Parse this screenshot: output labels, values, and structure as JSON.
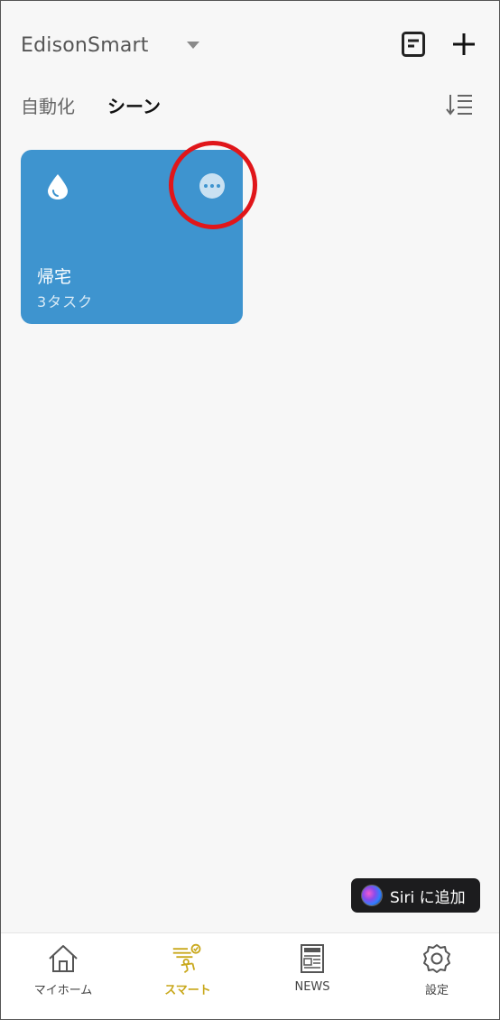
{
  "header": {
    "home_name": "EdisonSmart",
    "icons": {
      "log": "document-list-icon",
      "add": "plus-icon",
      "dropdown": "caret-down-icon"
    }
  },
  "tabs": [
    {
      "label": "自動化",
      "active": false
    },
    {
      "label": "シーン",
      "active": true
    }
  ],
  "sort_icon": "sort-icon",
  "scenes": [
    {
      "name": "帰宅",
      "tasks": "3タスク",
      "icon": "water-drop-icon",
      "color": "#3e94cf"
    }
  ],
  "siri": {
    "label": "Siri に追加"
  },
  "bottom_nav": [
    {
      "label": "マイホーム",
      "icon": "home-icon",
      "active": false
    },
    {
      "label": "スマート",
      "icon": "smart-icon",
      "active": true
    },
    {
      "label": "NEWS",
      "icon": "newspaper-icon",
      "active": false
    },
    {
      "label": "設定",
      "icon": "gear-icon",
      "active": false
    }
  ],
  "colors": {
    "accent": "#c9a81c",
    "card": "#3e94cf",
    "highlight": "#e0161a",
    "background": "#f7f7f7"
  }
}
